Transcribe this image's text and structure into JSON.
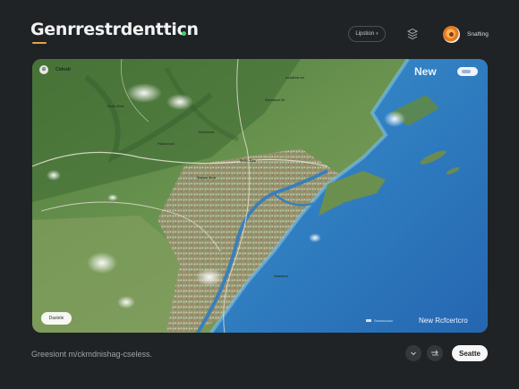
{
  "header": {
    "title": "Genrrestrdentticn",
    "location_label": "Lipstion",
    "user_name": "Snafting"
  },
  "map": {
    "title": "Cidnslt",
    "new_label": "New",
    "scale_label": "Daslele",
    "legend_text": "Seosocoioo",
    "region_label": "New Rcfcertcro",
    "place_labels": [
      "Ssda Slas",
      "Stoaisoo Sr",
      "Dobnssd",
      "Fladorsas",
      "Seiin Sas",
      "sssdion sn",
      "Ssiron Snlr",
      "Snatonn"
    ],
    "colors": {
      "land": "#5e8a4a",
      "water": "#2f7fc4",
      "river": "#3b7fb8"
    }
  },
  "footer": {
    "description": "Greesiont m/ckmdnishag-cseless.",
    "search_label": "Seatte"
  }
}
